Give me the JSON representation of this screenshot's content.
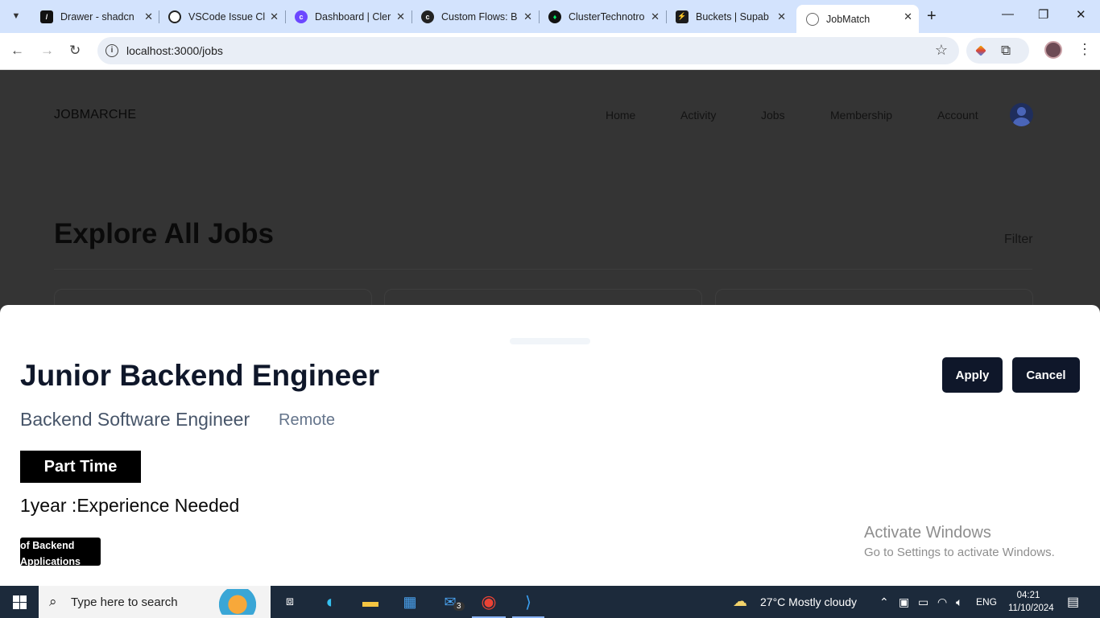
{
  "browser": {
    "tabs": [
      {
        "title": "Drawer - shadcn",
        "icon": "shadcn-icon"
      },
      {
        "title": "VSCode Issue Cl",
        "icon": "openai-icon"
      },
      {
        "title": "Dashboard | Cler",
        "icon": "clerk-icon"
      },
      {
        "title": "Custom Flows: B",
        "icon": "clerk-icon"
      },
      {
        "title": "ClusterTechnotro",
        "icon": "mongodb-icon"
      },
      {
        "title": "Buckets | Supab",
        "icon": "supabase-icon"
      },
      {
        "title": "JobMatch",
        "icon": "globe-icon",
        "active": true
      }
    ],
    "url": "localhost:3000/jobs"
  },
  "site": {
    "brand": "JOBMARCHE",
    "nav": [
      "Home",
      "Activity",
      "Jobs",
      "Membership",
      "Account"
    ],
    "page_title": "Explore All Jobs",
    "filter_label": "Filter"
  },
  "drawer": {
    "job_title": "Junior Backend Engineer",
    "role": "Backend Software Engineer",
    "location": "Remote",
    "employment_type": "Part Time",
    "experience": "1year :Experience Needed",
    "skill_badge": "of Backend Applications and",
    "apply_label": "Apply",
    "cancel_label": "Cancel"
  },
  "watermark": {
    "line1": "Activate Windows",
    "line2": "Go to Settings to activate Windows."
  },
  "taskbar": {
    "search_placeholder": "Type here to search",
    "mail_badge": "3",
    "weather": "27°C  Mostly cloudy",
    "lang": "ENG",
    "time": "04:21",
    "date": "11/10/2024"
  },
  "colors": {
    "overlay_bg": "#343434",
    "primary": "#0f172a",
    "badge": "#000000",
    "taskbar": "#1c2a3b"
  }
}
